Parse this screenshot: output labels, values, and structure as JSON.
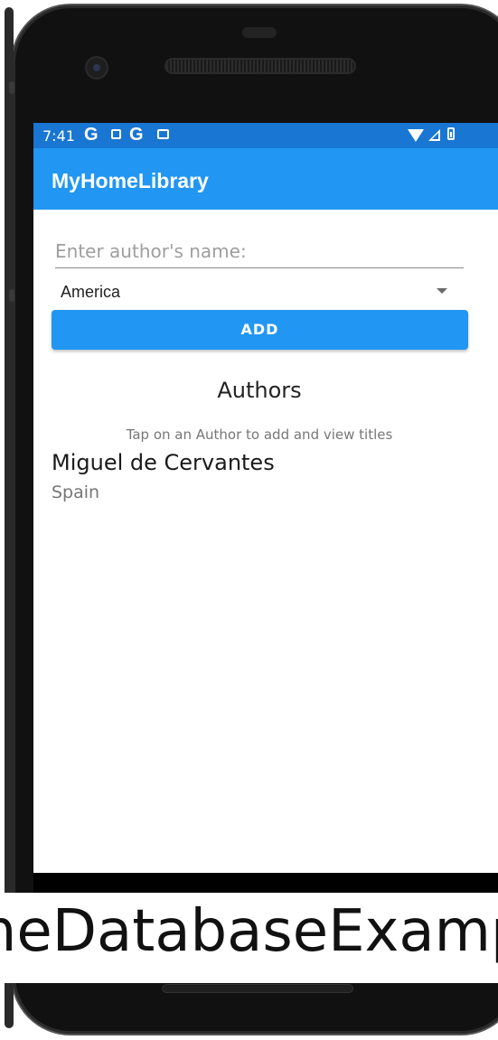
{
  "status_bar": {
    "time": "7:41",
    "icons": [
      "google-icon",
      "text-icon",
      "google-icon",
      "calendar-icon",
      "wifi-icon",
      "signal-icon",
      "battery-icon"
    ],
    "g_letter": "G"
  },
  "app": {
    "title": "MyHomeLibrary"
  },
  "form": {
    "author_placeholder": "Enter author's name:",
    "author_value": "",
    "country_selected": "America",
    "add_label": "ADD"
  },
  "authors": {
    "heading": "Authors",
    "hint": "Tap on an Author to add and view titles",
    "items": [
      {
        "name": "Miguel de Cervantes",
        "country": "Spain"
      }
    ]
  },
  "banner": {
    "text": "meDatabaseExampl"
  },
  "colors": {
    "status_bar": "#1976d2",
    "app_bar": "#2196f3",
    "button": "#2196f3"
  }
}
